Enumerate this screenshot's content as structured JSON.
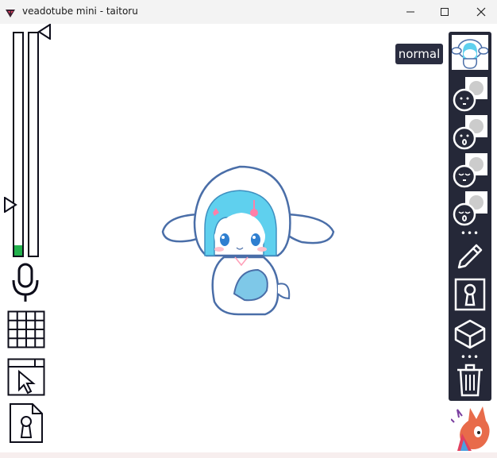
{
  "window": {
    "title": "veadotube mini - taitoru",
    "controls": {
      "minimize": "minimize-icon",
      "maximize": "maximize-icon",
      "close": "close-icon"
    }
  },
  "meters": {
    "input_level_fraction": 0.045,
    "threshold_fraction": 0.23,
    "fill_color": "#22b14c"
  },
  "left_toolbar": {
    "icons": [
      "microphone-icon",
      "grid-icon",
      "window-cursor-icon",
      "file-lock-icon"
    ]
  },
  "tooltip": {
    "text": "normal"
  },
  "right_panel": {
    "states": [
      "avatar-normal-thumbnail",
      "avatar-state-2-thumbnail",
      "avatar-state-3-thumbnail",
      "avatar-state-4-thumbnail",
      "avatar-state-5-thumbnail"
    ],
    "dots": "•••",
    "tools": [
      "pencil-icon",
      "keyhole-icon",
      "box-icon"
    ],
    "dots2": "•••",
    "delete": "trash-icon",
    "colors": {
      "panel": "#252838",
      "tooltip": "#2a2d40",
      "accent": "#4a6ea8"
    }
  }
}
